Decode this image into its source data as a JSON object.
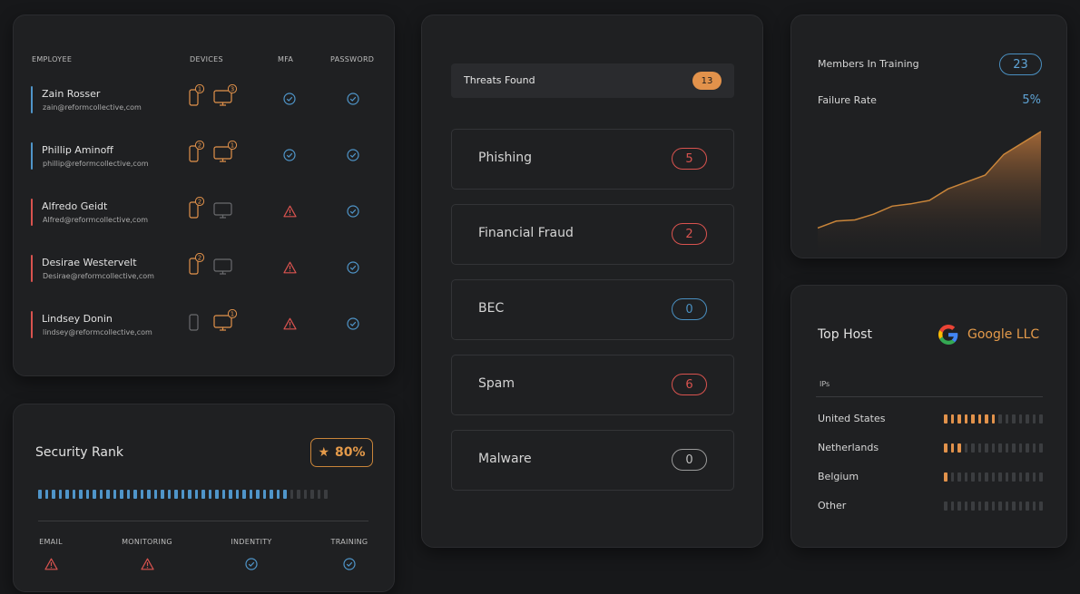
{
  "employees": {
    "headers": {
      "employee": "EMPLOYEE",
      "devices": "DEVICES",
      "mfa": "MFA",
      "password": "PASSWORD"
    },
    "rows": [
      {
        "name": "Zain Rosser",
        "email": "zain@reformcollective,com",
        "phone_count": "1",
        "desktop_count": "3",
        "phone_active": true,
        "desktop_active": true,
        "mfa": "ok",
        "password": "ok",
        "bar_color": "#4f95c9"
      },
      {
        "name": "Phillip Aminoff",
        "email": "phillip@reformcollective,com",
        "phone_count": "2",
        "desktop_count": "1",
        "phone_active": true,
        "desktop_active": true,
        "mfa": "ok",
        "password": "ok",
        "bar_color": "#4f95c9"
      },
      {
        "name": "Alfredo Geidt",
        "email": "Alfred@reformcollective,com",
        "phone_count": "2",
        "desktop_count": "",
        "phone_active": true,
        "desktop_active": false,
        "mfa": "warn",
        "password": "ok",
        "bar_color": "#d9534f"
      },
      {
        "name": "Desirae Westervelt",
        "email": "Desirae@reformcollective,com",
        "phone_count": "2",
        "desktop_count": "",
        "phone_active": true,
        "desktop_active": false,
        "mfa": "warn",
        "password": "ok",
        "bar_color": "#d9534f"
      },
      {
        "name": "Lindsey Donin",
        "email": "lindsey@reformcollective,com",
        "phone_count": "",
        "desktop_count": "1",
        "phone_active": false,
        "desktop_active": true,
        "mfa": "warn",
        "password": "ok",
        "bar_color": "#d9534f"
      }
    ]
  },
  "security_rank": {
    "title": "Security Rank",
    "score": "80%",
    "star_icon": "star-icon",
    "level_fraction": 0.86,
    "categories": [
      {
        "label": "EMAIL",
        "status": "warn"
      },
      {
        "label": "MONITORING",
        "status": "warn"
      },
      {
        "label": "INDENTITY",
        "status": "ok"
      },
      {
        "label": "TRAINING",
        "status": "ok"
      }
    ]
  },
  "threats": {
    "header_label": "Threats Found",
    "header_count": "13",
    "items": [
      {
        "label": "Phishing",
        "count": "5",
        "color": "#d9534f"
      },
      {
        "label": "Financial Fraud",
        "count": "2",
        "color": "#d9534f"
      },
      {
        "label": "BEC",
        "count": "0",
        "color": "#4a8fc0"
      },
      {
        "label": "Spam",
        "count": "6",
        "color": "#d9534f"
      },
      {
        "label": "Malware",
        "count": "0",
        "color": "#9a9a9a"
      }
    ]
  },
  "training": {
    "members_label": "Members In Training",
    "members_count": "23",
    "failure_label": "Failure Rate",
    "failure_rate": "5%",
    "chart_data": {
      "type": "area",
      "values": [
        3,
        6,
        6.5,
        9,
        12.5,
        13.5,
        15,
        20,
        23,
        26,
        35,
        40,
        45
      ]
    }
  },
  "top_host": {
    "title": "Top Host",
    "host_name": "Google LLC",
    "logo_icon": "google-logo-icon",
    "subheader": "IPs",
    "rows": [
      {
        "country": "United States",
        "level_fraction": 0.5
      },
      {
        "country": "Netherlands",
        "level_fraction": 0.17
      },
      {
        "country": "Belgium",
        "level_fraction": 0.06
      },
      {
        "country": "Other",
        "level_fraction": 0
      }
    ]
  },
  "colors": {
    "accent_orange": "#e2924b",
    "accent_blue": "#4f95c9",
    "warn_red": "#d9534f"
  }
}
